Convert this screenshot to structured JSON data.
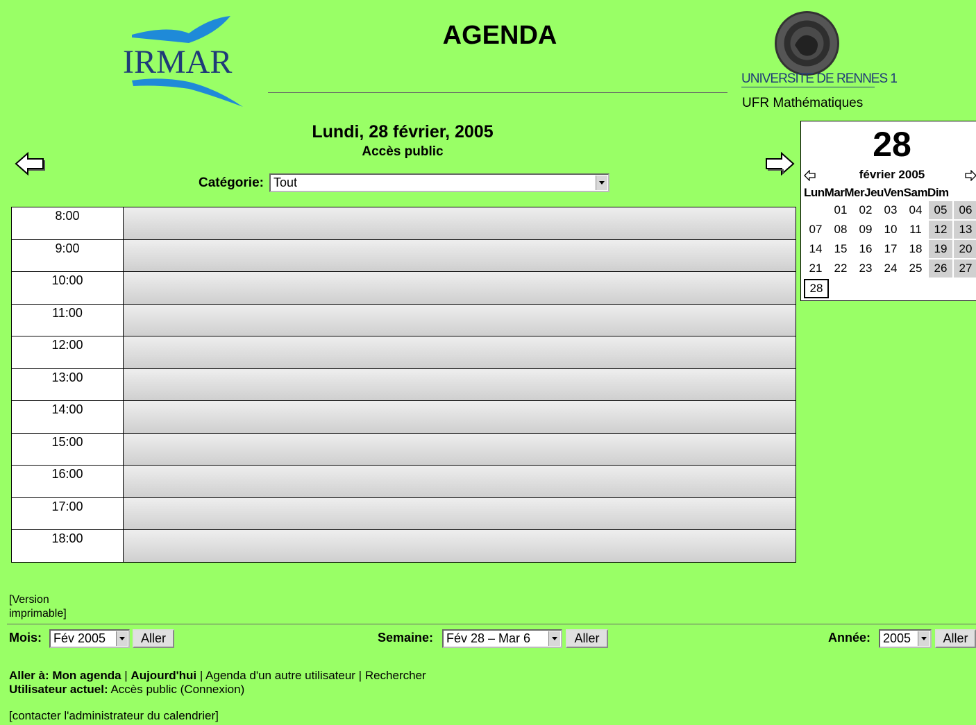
{
  "header": {
    "logo_left_text": "IRMAR",
    "app_title": "AGENDA",
    "university": "UNIVERSITE DE RENNES 1",
    "ufr": "UFR Mathématiques"
  },
  "day_view": {
    "date_heading": "Lundi, 28 février, 2005",
    "access": "Accès public",
    "category_label": "Catégorie:",
    "category_value": "Tout",
    "hours": [
      "8:00",
      "9:00",
      "10:00",
      "11:00",
      "12:00",
      "13:00",
      "14:00",
      "15:00",
      "16:00",
      "17:00",
      "18:00"
    ]
  },
  "mini_calendar": {
    "day": "28",
    "month": "février 2005",
    "weekdays": "LunMarMerJeuVenSamDim",
    "weeks": [
      [
        "",
        "01",
        "02",
        "03",
        "04",
        "05",
        "06"
      ],
      [
        "07",
        "08",
        "09",
        "10",
        "11",
        "12",
        "13"
      ],
      [
        "14",
        "15",
        "16",
        "17",
        "18",
        "19",
        "20"
      ],
      [
        "21",
        "22",
        "23",
        "24",
        "25",
        "26",
        "27"
      ],
      [
        "28",
        "",
        "",
        "",
        "",
        "",
        ""
      ]
    ],
    "today": "28"
  },
  "footer": {
    "print_version": "[Version imprimable]",
    "month_label": "Mois:",
    "month_value": "Fév 2005",
    "week_label": "Semaine:",
    "week_value": "Fév 28 – Mar 6",
    "year_label": "Année:",
    "year_value": "2005",
    "go_button": "Aller",
    "goto_label": "Aller à:",
    "link_my_agenda": "Mon agenda",
    "link_today": "Aujourd'hui",
    "link_other_user": "Agenda d'un autre utilisateur",
    "link_search": "Rechercher",
    "current_user_label": "Utilisateur actuel:",
    "current_user_value": "Accès public",
    "login_link": "(Connexion)",
    "contact_link": "[contacter l'administrateur du calendrier]"
  },
  "colors": {
    "background": "#99ff66",
    "logo_blue": "#1f3b78",
    "weekend_cell": "#d0d0d0"
  }
}
